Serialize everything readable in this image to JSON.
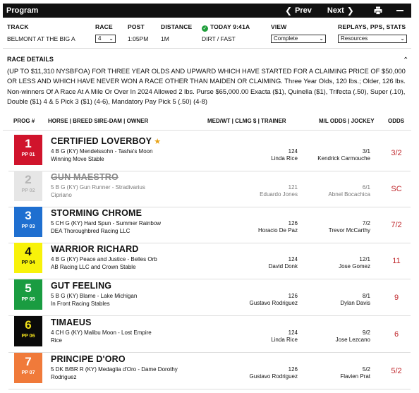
{
  "header": {
    "title": "Program",
    "prev_label": "Prev",
    "next_label": "Next"
  },
  "filters": {
    "track_label": "TRACK",
    "track_value": "BELMONT AT THE BIG A",
    "race_label": "RACE",
    "race_value": "4",
    "post_label": "POST",
    "post_value": "1:05PM",
    "distance_label": "DISTANCE",
    "distance_value": "1M",
    "today_label": "TODAY 9:41A",
    "surface_value": "DIRT / FAST",
    "view_label": "VIEW",
    "view_value": "Complete",
    "replays_label": "REPLAYS, PPS, STATS",
    "replays_value": "Resources"
  },
  "race_details": {
    "title": "RACE DETAILS",
    "text": "(UP TO $11,310 NYSBFOA) FOR THREE YEAR OLDS AND UPWARD WHICH HAVE STARTED FOR A CLAIMING PRICE OF $50,000 OR LESS AND WHICH HAVE NEVER WON A RACE OTHER THAN MAIDEN OR CLAIMING. Three Year Olds, 120 lbs.; Older, 126 lbs. Non-winners Of A Race At A Mile Or Over In 2024 Allowed 2 lbs. Purse $65,000.00 Exacta ($1), Quinella ($1), Trifecta (.50), Super (.10), Double ($1) 4 & 5 Pick 3 ($1) (4-6), Mandatory Pay Pick 5 (.50) (4-8)"
  },
  "columns": {
    "prog": "PROG #",
    "horse": "HORSE | BREED SIRE-DAM | OWNER",
    "med": "MED/WT | CLMG $ | TRAINER",
    "ml": "M/L ODDS | JOCKEY",
    "odds": "ODDS"
  },
  "entries": [
    {
      "num": "1",
      "pp": "PP 01",
      "horse": "CERTIFIED LOVERBOY",
      "breed": "4 B G (KY) Mendelssohn - Tasha's Moon",
      "owner": "Winning Move Stable",
      "weight": "124",
      "trainer": "Linda Rice",
      "ml": "3/1",
      "jockey": "Kendrick Carmouche",
      "odds": "3/2",
      "bg": "#d0142c",
      "fg": "#ffffff",
      "scratched": false,
      "star": true
    },
    {
      "num": "2",
      "pp": "PP 02",
      "horse": "GUN MAESTRO",
      "breed": "5 B G (KY) Gun Runner - Stradivarius",
      "owner": "Cipriano",
      "weight": "121",
      "trainer": "Eduardo Jones",
      "ml": "6/1",
      "jockey": "Abnel Bocachica",
      "odds": "SC",
      "bg": "#e6e6e6",
      "fg": "#b5b5b5",
      "scratched": true,
      "star": false
    },
    {
      "num": "3",
      "pp": "PP 03",
      "horse": "STORMING CHROME",
      "breed": "5 CH G (KY) Hard Spun - Summer Rainbow",
      "owner": "DEA Thoroughbred Racing LLC",
      "weight": "126",
      "trainer": "Horacio De Paz",
      "ml": "7/2",
      "jockey": "Trevor McCarthy",
      "odds": "7/2",
      "bg": "#1f6fd0",
      "fg": "#ffffff",
      "scratched": false,
      "star": false
    },
    {
      "num": "4",
      "pp": "PP 04",
      "horse": "WARRIOR RICHARD",
      "breed": "4 B G (KY) Peace and Justice - Belles Orb",
      "owner": "AB Racing LLC and Crown Stable",
      "weight": "124",
      "trainer": "David Donk",
      "ml": "12/1",
      "jockey": "Jose Gomez",
      "odds": "11",
      "bg": "#f8f20a",
      "fg": "#111111",
      "scratched": false,
      "star": false
    },
    {
      "num": "5",
      "pp": "PP 05",
      "horse": "GUT FEELING",
      "breed": "5 B G (KY) Blame - Lake Michigan",
      "owner": "In Front Racing Stables",
      "weight": "126",
      "trainer": "Gustavo Rodriguez",
      "ml": "8/1",
      "jockey": "Dylan Davis",
      "odds": "9",
      "bg": "#1a9c41",
      "fg": "#ffffff",
      "scratched": false,
      "star": false
    },
    {
      "num": "6",
      "pp": "PP 06",
      "horse": "TIMAEUS",
      "breed": "4 CH G (KY) Malibu Moon - Lost Empire",
      "owner": "Rice",
      "weight": "124",
      "trainer": "Linda Rice",
      "ml": "9/2",
      "jockey": "Jose Lezcano",
      "odds": "6",
      "bg": "#0a0a0a",
      "fg": "#f2e21c",
      "scratched": false,
      "star": false
    },
    {
      "num": "7",
      "pp": "PP 07",
      "horse": "PRINCIPE D'ORO",
      "breed": "5 DK B/BR R (KY) Medaglia d'Oro - Dame Dorothy",
      "owner": "Rodriguez",
      "weight": "126",
      "trainer": "Gustavo Rodriguez",
      "ml": "5/2",
      "jockey": "Flavien Prat",
      "odds": "5/2",
      "bg": "#f07a3a",
      "fg": "#ffffff",
      "scratched": false,
      "star": false
    }
  ]
}
